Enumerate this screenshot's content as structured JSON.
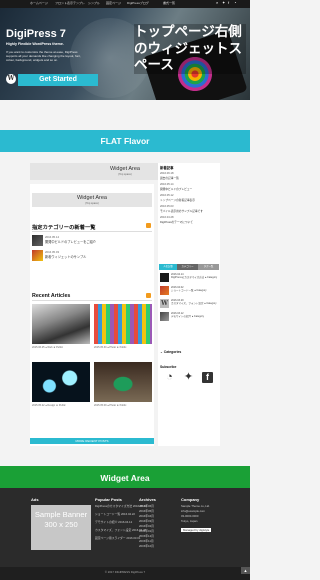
{
  "topnav": {
    "items": [
      "ホームページ",
      "フロント表示テンプレ",
      "シンプル",
      "固定ページ",
      "DigiPressブログ",
      "書式一覧"
    ]
  },
  "hero": {
    "title": "DigiPress 7",
    "subtitle": "Highly Flexible WordPress theme.",
    "description": "If you want to customize the theme at ease, DigiPress supports all your demands like changing the layout, font, colour, background, widgets and so on.",
    "button_label": "Get Started",
    "overlay_text": "トップページ右側のウィジェットスペース"
  },
  "flat": {
    "label": "FLAT Flavor"
  },
  "widget_top": {
    "title": "Widget Area",
    "sub": "(Top space)"
  },
  "widget_mid": {
    "title": "Widget Area",
    "sub": "(Top space)"
  },
  "category": {
    "title": "指定カテゴリーの新着一覧",
    "posts": [
      {
        "date": "2016.05.14",
        "title": "開発中ビルドのプレビューをご紹介"
      },
      {
        "date": "2016.05.03",
        "title": "新着ウィジェットのサンプル"
      }
    ]
  },
  "recent": {
    "title": "Recent Articles",
    "cards": [
      {
        "meta": "2015.06.25  ● Web  ★ Public"
      },
      {
        "meta": "2015.05.30  ● Photo  ★ Public"
      },
      {
        "meta": "2015.05.22  ● Design  ★ Public"
      },
      {
        "meta": "2015.05.09  ● Photo  ★ Public"
      }
    ],
    "load_more": "MORE RECENT POSTS"
  },
  "sidebar": {
    "new_title": "新着記事",
    "new_items": [
      {
        "date": "2016.06.18",
        "title": "過去の記事一覧"
      },
      {
        "date": "2016.05.14",
        "title": "開発中ビルドのプレビュー"
      },
      {
        "date": "2016.05.12",
        "title": "トップページの新着記事表示"
      },
      {
        "date": "2016.05.03",
        "title": "モバイル表示用のサンプル記事です"
      },
      {
        "date": "2016.04.28",
        "title": "DigiPressのテーマについて"
      }
    ],
    "tabs": [
      "人気記事",
      "カテゴリー",
      "タグ一覧"
    ],
    "tab_posts": [
      {
        "date": "2016.04.14",
        "title": "DigiPressのカスタマイズ方法 ● Category"
      },
      {
        "date": "2016.04.02",
        "title": "ショートコード一覧 ● Category"
      },
      {
        "date": "2016.03.29",
        "title": "カスタマイズ、フォント設定 ● Category"
      },
      {
        "date": "2016.03.12",
        "title": "デモサイトの紹介 ● Category"
      }
    ],
    "categories_label": "Categories",
    "subscribe": "Subscribe"
  },
  "widget_green": {
    "title": "Widget Area"
  },
  "footer": {
    "ads": {
      "title": "Ads",
      "banner": "Sample Banner 300 x 250"
    },
    "popular": {
      "title": "Popular Posts",
      "items": [
        "DigiPressのカスタマイズ方法 2016.05.10",
        "ショートコード一覧 2016.04.22",
        "デモサイトの紹介 2016.04.12",
        "カスタマイズ、フォント設定 2016.03.28",
        "固定ページ用スライダー 2016.03.01"
      ]
    },
    "archives": {
      "title": "Archives",
      "items": [
        "2016年06月",
        "2016年05月",
        "2016年04月",
        "2016年03月",
        "2016年02月",
        "2016年01月",
        "2015年12月",
        "2015年11月",
        "2015年10月"
      ]
    },
    "company": {
      "title": "Company",
      "items": [
        "Sample Theme co.,Ltd.",
        "info@example.com",
        "03-0000-0000",
        "Tokyo, Japan"
      ],
      "badge": "Managed by digistyle"
    }
  },
  "bottom": {
    "copyright": "© 2017 DIGIPRESS DigiPress 7"
  },
  "colors": {
    "accent": "#2bbad0",
    "green": "#1aa036",
    "footer": "#2b2b2b"
  }
}
